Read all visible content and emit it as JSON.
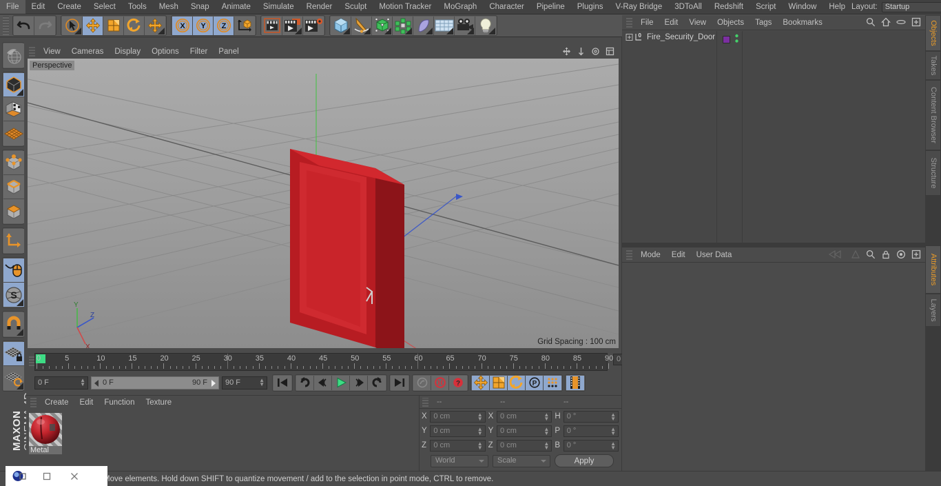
{
  "menubar": {
    "items": [
      "File",
      "Edit",
      "Create",
      "Select",
      "Tools",
      "Mesh",
      "Snap",
      "Animate",
      "Simulate",
      "Render",
      "Sculpt",
      "Motion Tracker",
      "MoGraph",
      "Character",
      "Pipeline",
      "Plugins",
      "V-Ray Bridge",
      "3DToAll",
      "Redshift",
      "Script",
      "Window",
      "Help"
    ],
    "layout_label": "Layout:",
    "layout_value": "Startup",
    "search_icon": "search-icon"
  },
  "toolbar": {
    "groups": [
      {
        "name": "history",
        "buttons": [
          {
            "name": "undo-button",
            "icon": "undo-icon",
            "selected": false,
            "corner": false
          },
          {
            "name": "redo-button",
            "icon": "redo-icon",
            "selected": false,
            "corner": false
          }
        ]
      },
      {
        "name": "transform",
        "buttons": [
          {
            "name": "live-selection-tool",
            "icon": "cursor-circle-icon",
            "selected": false,
            "corner": true
          },
          {
            "name": "move-tool",
            "icon": "move-arrows-icon",
            "selected": true,
            "corner": false
          },
          {
            "name": "scale-tool",
            "icon": "scale-box-icon",
            "selected": false,
            "corner": false
          },
          {
            "name": "rotate-tool",
            "icon": "rotate-arrows-icon",
            "selected": false,
            "corner": false
          },
          {
            "name": "move-alt-tool",
            "icon": "move-arrows-icon",
            "selected": false,
            "corner": true
          }
        ]
      },
      {
        "name": "axis-locks",
        "buttons": [
          {
            "name": "lock-x-axis-button",
            "icon": "x-axis-icon",
            "selected": true,
            "corner": false
          },
          {
            "name": "lock-y-axis-button",
            "icon": "y-axis-icon",
            "selected": true,
            "corner": false
          },
          {
            "name": "lock-z-axis-button",
            "icon": "z-axis-icon",
            "selected": true,
            "corner": false
          },
          {
            "name": "world-object-coordinates-button",
            "icon": "axis-cube-icon",
            "selected": false,
            "corner": false
          }
        ]
      },
      {
        "name": "render",
        "buttons": [
          {
            "name": "render-view-button",
            "icon": "clapper-icon",
            "selected": false,
            "corner": false
          },
          {
            "name": "render-to-picture-viewer-button",
            "icon": "clapper-picture-icon",
            "selected": false,
            "corner": true
          },
          {
            "name": "render-settings-button",
            "icon": "clapper-gear-icon",
            "selected": false,
            "corner": false
          }
        ]
      },
      {
        "name": "create",
        "buttons": [
          {
            "name": "add-cube-object-button",
            "icon": "cube-icon",
            "selected": false,
            "corner": true
          },
          {
            "name": "add-spline-button",
            "icon": "pen-spline-icon",
            "selected": false,
            "corner": true
          },
          {
            "name": "add-generator-button",
            "icon": "green-cube-icon",
            "selected": false,
            "corner": true
          },
          {
            "name": "add-mograph-button",
            "icon": "cloner-icon",
            "selected": false,
            "corner": true
          },
          {
            "name": "add-deformer-button",
            "icon": "bend-deformer-icon",
            "selected": false,
            "corner": true
          },
          {
            "name": "add-environment-button",
            "icon": "floor-grid-icon",
            "selected": false,
            "corner": true
          },
          {
            "name": "add-camera-button",
            "icon": "camera-icon",
            "selected": false,
            "corner": true
          },
          {
            "name": "add-light-button",
            "icon": "light-bulb-icon",
            "selected": false,
            "corner": true
          }
        ]
      }
    ]
  },
  "left_toolbar": {
    "groups": [
      [
        {
          "name": "undo-view-button",
          "icon": "globe-icon",
          "selected": false,
          "corner": false
        }
      ],
      [
        {
          "name": "model-mode-button",
          "icon": "dark-cube-icon",
          "selected": true,
          "corner": true
        },
        {
          "name": "texture-mode-button",
          "icon": "checker-cube-icon",
          "selected": false,
          "corner": false
        },
        {
          "name": "workplane-mode-button",
          "icon": "orange-grid-icon",
          "selected": false,
          "corner": false
        }
      ],
      [
        {
          "name": "points-mode-button",
          "icon": "points-cube-icon",
          "selected": false,
          "corner": false
        },
        {
          "name": "edges-mode-button",
          "icon": "edges-cube-icon",
          "selected": false,
          "corner": false
        },
        {
          "name": "polygons-mode-button",
          "icon": "polygons-cube-icon",
          "selected": false,
          "corner": false
        }
      ],
      [
        {
          "name": "object-axis-mode-button",
          "icon": "axis-l-icon",
          "selected": false,
          "corner": false
        }
      ],
      [
        {
          "name": "enable-snap-button",
          "icon": "mouse-icon",
          "selected": true,
          "corner": false
        },
        {
          "name": "soft-selection-button",
          "icon": "s-ball-icon",
          "selected": true,
          "corner": true
        }
      ],
      [
        {
          "name": "magnet-tool-button",
          "icon": "magnet-icon",
          "selected": false,
          "corner": true
        }
      ],
      [
        {
          "name": "lock-workplane-button",
          "icon": "grid-lock-icon",
          "selected": true,
          "corner": false
        },
        {
          "name": "planar-workplane-button",
          "icon": "grid-rotate-icon",
          "selected": false,
          "corner": true
        }
      ]
    ],
    "brand_top": "MAXON",
    "brand_bottom": "CINEMA 4D"
  },
  "viewport": {
    "menu_items": [
      "View",
      "Cameras",
      "Display",
      "Options",
      "Filter",
      "Panel"
    ],
    "view_label": "Perspective",
    "grid_spacing": "Grid Spacing : 100 cm",
    "axis_labels": {
      "x": "X",
      "y": "Y",
      "z": "Z"
    },
    "object_color": "#c9242a",
    "panel_icons": [
      "move-view-icon",
      "scale-view-icon",
      "rotate-view-icon",
      "maximize-view-icon"
    ]
  },
  "timeline": {
    "tick_labels": [
      "0",
      "5",
      "10",
      "15",
      "20",
      "25",
      "30",
      "35",
      "40",
      "45",
      "50",
      "55",
      "60",
      "65",
      "70",
      "75",
      "80",
      "85",
      "90"
    ],
    "current_frame_field": "0 F",
    "start_frame_field": "0 F",
    "range_low": "0 F",
    "range_high": "90 F",
    "end_frame_field": "90 F",
    "transport": [
      {
        "name": "go-to-start-button",
        "icon": "skip-start-icon",
        "selected": false
      },
      {
        "name": "previous-keyframe-button",
        "icon": "prev-key-icon",
        "selected": false
      },
      {
        "name": "step-back-button",
        "icon": "step-back-icon",
        "selected": false
      },
      {
        "name": "play-button",
        "icon": "play-icon",
        "selected": false
      },
      {
        "name": "step-forward-button",
        "icon": "step-forward-icon",
        "selected": false
      },
      {
        "name": "next-keyframe-button",
        "icon": "next-key-icon",
        "selected": false
      },
      {
        "name": "go-to-end-button",
        "icon": "skip-end-icon",
        "selected": false
      }
    ],
    "record_group": [
      {
        "name": "autokeying-button",
        "icon": "key-icon",
        "selected": false
      },
      {
        "name": "record-active-objects-button",
        "icon": "record-circle-icon",
        "selected": false
      },
      {
        "name": "keyframe-help-button",
        "icon": "question-circle-icon",
        "selected": false
      }
    ],
    "key_group": [
      {
        "name": "record-position-button",
        "icon": "move-arrows-icon",
        "selected": true
      },
      {
        "name": "record-scale-button",
        "icon": "scale-box-icon",
        "selected": true
      },
      {
        "name": "record-rotation-button",
        "icon": "rotate-arrows-icon",
        "selected": true
      },
      {
        "name": "record-parameter-button",
        "icon": "p-circle-icon",
        "selected": true
      },
      {
        "name": "record-pla-button",
        "icon": "dots-grid-icon",
        "selected": true
      }
    ],
    "film_button": {
      "name": "timeline-filmstrip-button",
      "icon": "filmstrip-icon",
      "selected": true
    }
  },
  "material_manager": {
    "menu_items": [
      "Create",
      "Edit",
      "Function",
      "Texture"
    ],
    "materials": [
      {
        "name": "Metal",
        "color": "#c3242c"
      }
    ]
  },
  "coordinates": {
    "headers": [
      "--",
      "--",
      "--"
    ],
    "rows": [
      {
        "label1": "X",
        "value1": "0 cm",
        "label2": "X",
        "value2": "0 cm",
        "label3": "H",
        "value3": "0 °"
      },
      {
        "label1": "Y",
        "value1": "0 cm",
        "label2": "Y",
        "value2": "0 cm",
        "label3": "P",
        "value3": "0 °"
      },
      {
        "label1": "Z",
        "value1": "0 cm",
        "label2": "Z",
        "value2": "0 cm",
        "label3": "B",
        "value3": "0 °"
      }
    ],
    "system_select": "World",
    "mode_select": "Scale",
    "apply_button": "Apply"
  },
  "object_manager": {
    "menu_items": [
      "File",
      "Edit",
      "View",
      "Objects",
      "Tags",
      "Bookmarks"
    ],
    "icons": [
      "search-icon",
      "home-icon",
      "eye-icon",
      "plus-box-icon"
    ],
    "object_name": "Fire_Security_Door",
    "object_layer": "0",
    "tag_color": "#7b2fa0"
  },
  "attribute_manager": {
    "menu_items": [
      "Mode",
      "Edit",
      "User Data"
    ],
    "icons": [
      "back-arrow-icon",
      "forward-arrow-icon",
      "search-icon",
      "lock-icon",
      "target-icon",
      "plus-box-icon"
    ]
  },
  "vertical_tabs": {
    "top": [
      {
        "label": "Objects",
        "active": true
      },
      {
        "label": "Takes",
        "active": false
      },
      {
        "label": "Content Browser",
        "active": false
      },
      {
        "label": "Structure",
        "active": false
      }
    ],
    "bottom": [
      {
        "label": "Attributes",
        "active": true
      },
      {
        "label": "Layers",
        "active": false
      }
    ]
  },
  "statusbar": {
    "message": "Move elements. Hold down SHIFT to quantize movement / add to the selection in point mode, CTRL to remove."
  },
  "taskbar": {
    "buttons": [
      {
        "name": "cinema4d-app-icon",
        "icon": "c4d-logo-icon"
      },
      {
        "name": "restore-window-button",
        "icon": "restore-icon"
      },
      {
        "name": "maximize-window-button",
        "icon": "square-icon"
      },
      {
        "name": "close-window-button",
        "icon": "close-icon"
      }
    ]
  },
  "colors": {
    "accent_orange": "#e89b2a",
    "selection_blue": "#8fa8ce",
    "object_red": "#c9242a",
    "tag_purple": "#7b2fa0"
  }
}
